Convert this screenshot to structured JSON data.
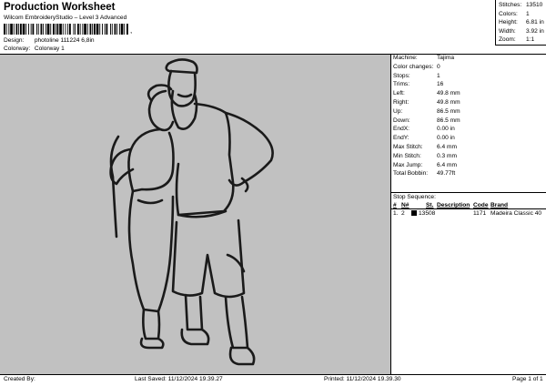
{
  "header": {
    "title": "Production Worksheet",
    "subtitle": "Wilcom EmbroideryStudio – Level 3 Advanced",
    "barcode_mark": ",",
    "design_label": "Design:",
    "design_value": "photoline 111224 6,8in",
    "colorway_label": "Colorway:",
    "colorway_value": "Colorway 1"
  },
  "summary": [
    {
      "label": "Stitches:",
      "value": "13510"
    },
    {
      "label": "Colors:",
      "value": "1"
    },
    {
      "label": "Height:",
      "value": "6.81 in"
    },
    {
      "label": "Width:",
      "value": "3.92 in"
    },
    {
      "label": "Zoom:",
      "value": "1:1"
    }
  ],
  "info": [
    {
      "label": "Machine:",
      "value": "Tajima"
    },
    {
      "label": "Color changes:",
      "value": "0"
    },
    {
      "label": "Stops:",
      "value": "1"
    },
    {
      "label": "Trims:",
      "value": "16"
    },
    {
      "label": "Left:",
      "value": "49.8 mm"
    },
    {
      "label": "Right:",
      "value": "49.8 mm"
    },
    {
      "label": "Up:",
      "value": "86.5 mm"
    },
    {
      "label": "Down:",
      "value": "86.5 mm"
    },
    {
      "label": "EndX:",
      "value": "0.00 in"
    },
    {
      "label": "EndY:",
      "value": "0.00 in"
    },
    {
      "label": "Max Stitch:",
      "value": "6.4 mm"
    },
    {
      "label": "Min Stitch:",
      "value": "0.3 mm"
    },
    {
      "label": "Max Jump:",
      "value": "6.4 mm"
    },
    {
      "label": "Total Bobbin:",
      "value": "49.77ft"
    }
  ],
  "stop_sequence": {
    "title": "Stop Sequence:",
    "headers": {
      "num": "#",
      "n": "N#",
      "st": "St.",
      "description": "Description",
      "code": "Code",
      "brand": "Brand"
    },
    "rows": [
      {
        "num": "1.",
        "n": "2",
        "color": "#000000",
        "st": "13508",
        "description": "",
        "code": "1171",
        "brand": "Madeira Classic 40"
      }
    ]
  },
  "design": {
    "background": "#c1c1c1",
    "stroke_color": "#1a1a1a",
    "figure": "line-art-couple"
  },
  "footer": {
    "created_by": "Created By:",
    "last_saved": "Last Saved: 11/12/2024 19.39.27",
    "printed": "Printed: 11/12/2024 19.39.30",
    "page": "Page 1 of 1"
  }
}
